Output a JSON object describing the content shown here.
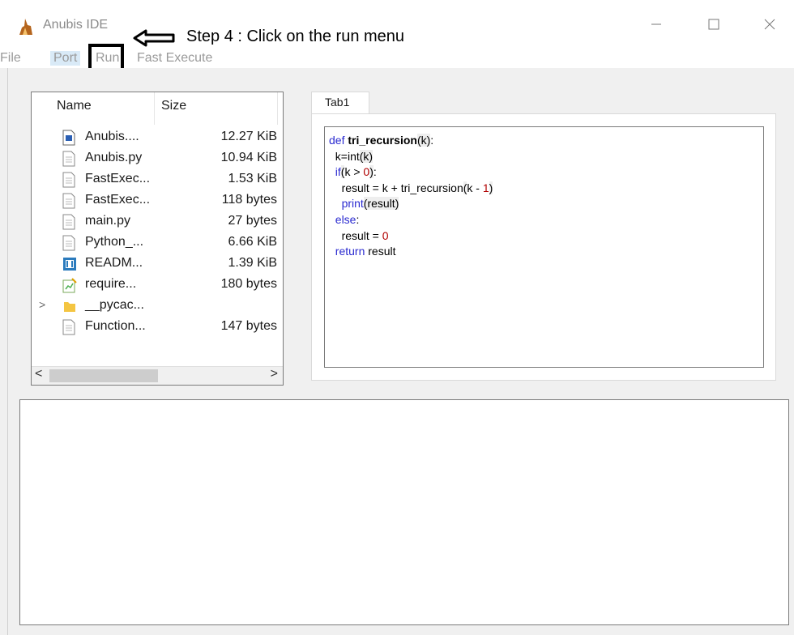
{
  "window": {
    "title": "Anubis IDE",
    "controls": {
      "minimize": "—",
      "maximize": "☐",
      "close": "✕"
    }
  },
  "annotation": {
    "text": "Step 4 : Click on the run menu",
    "arrow_icon": "left-arrow-icon"
  },
  "menu": {
    "items": [
      "File",
      "Port",
      "Run",
      "Fast Execute"
    ]
  },
  "file_tree": {
    "columns": [
      "Name",
      "Size"
    ],
    "files": [
      {
        "name": "Anubis....",
        "size": "12.27 KiB",
        "icon": "image-file-icon"
      },
      {
        "name": "Anubis.py",
        "size": "10.94 KiB",
        "icon": "document-icon"
      },
      {
        "name": "FastExec...",
        "size": "1.53 KiB",
        "icon": "document-icon"
      },
      {
        "name": "FastExec...",
        "size": "118 bytes",
        "icon": "document-icon"
      },
      {
        "name": "main.py",
        "size": "27 bytes",
        "icon": "document-icon"
      },
      {
        "name": "Python_...",
        "size": "6.66 KiB",
        "icon": "document-icon"
      },
      {
        "name": "READM...",
        "size": "1.39 KiB",
        "icon": "markdown-file-icon"
      },
      {
        "name": "require...",
        "size": "180 bytes",
        "icon": "text-file-icon"
      },
      {
        "name": "__pycac...",
        "size": "",
        "icon": "folder-icon"
      },
      {
        "name": "Function...",
        "size": "147 bytes",
        "icon": "document-icon"
      }
    ],
    "folder_expander": ">",
    "scroll": {
      "left": "<",
      "right": ">"
    }
  },
  "editor": {
    "tab_label": "Tab1",
    "code_lines": {
      "l1_def": "def",
      "l1_name": "tri_recursion",
      "l1_args": "(k)",
      "l1_colon": ":",
      "l2_a": "k=int",
      "l2_b": "(k)",
      "l3_kw": "if",
      "l3_open": "(",
      "l3_mid": "k > ",
      "l3_num": "0",
      "l3_close": ")",
      "l3_colon": ":",
      "l4_a": "result = k + tri_recursion",
      "l4_open": "(",
      "l4_mid": "k - ",
      "l4_num": "1",
      "l4_close": ")",
      "l5_kw": "print",
      "l5_args": "(result)",
      "l6_kw": "else",
      "l6_colon": ":",
      "l7_a": "result = ",
      "l7_num": "0",
      "l8_kw": "return",
      "l8_b": " result"
    }
  },
  "output_panel": {
    "text": ""
  }
}
